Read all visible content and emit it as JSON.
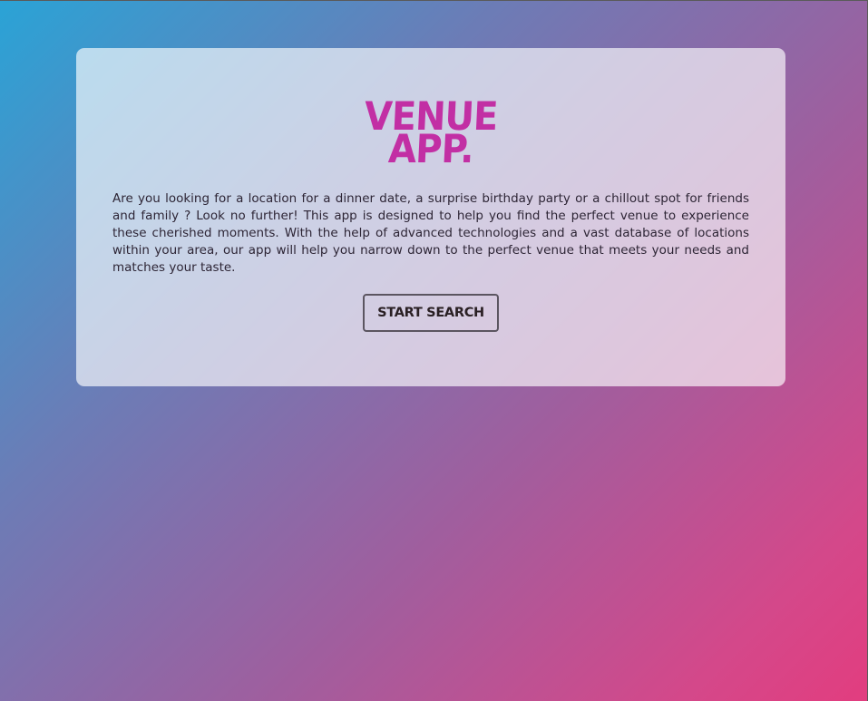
{
  "hero": {
    "logo_line1": "VENUE",
    "logo_line2": "APP.",
    "description": "Are you looking for a location for a dinner date, a surprise birthday party or a chillout spot for friends and family ? Look no further! This app is designed to help you find the perfect venue to experience these cherished moments. With the help of advanced technologies and a vast database of locations within your area, our app will help you narrow down to the perfect venue that meets your needs and matches your taste.",
    "start_button": "START SEARCH"
  },
  "colors": {
    "logo": "#c22fa4",
    "gradient_start": "#2aa3d6",
    "gradient_end": "#e23d7f",
    "text": "#2d2535"
  }
}
